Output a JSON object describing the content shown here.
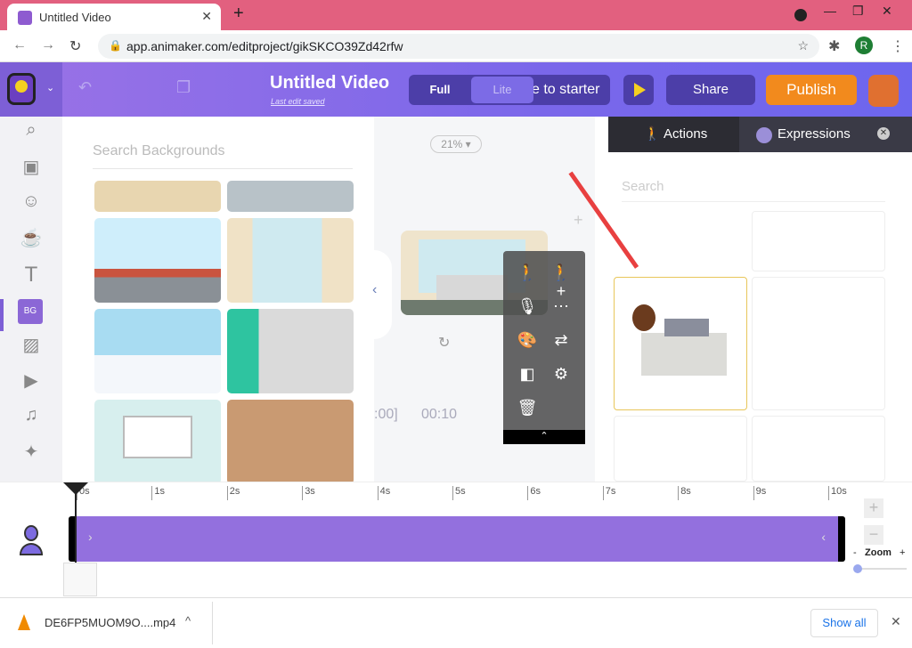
{
  "browser": {
    "tab_title": "Untitled Video",
    "url": "app.animaker.com/editproject/gikSKCO39Zd42rfw",
    "profile_initial": "R"
  },
  "header": {
    "title": "Untitled Video",
    "last_saved": "Last edit saved",
    "mode_full": "Full",
    "mode_lite": "Lite",
    "switch_label": "e to starter",
    "share": "Share",
    "publish": "Publish"
  },
  "left_rail": {
    "items": [
      "search-icon",
      "props-icon",
      "character-icon",
      "coffee-icon",
      "text-icon",
      "BG",
      "image-icon",
      "video-icon",
      "music-icon",
      "effects-icon"
    ],
    "selected": "BG"
  },
  "backgrounds": {
    "search_placeholder": "Search Backgrounds"
  },
  "canvas": {
    "zoom": "21%",
    "time_start": ":00]",
    "time_end": "00:10"
  },
  "right_panel": {
    "tab_actions": "Actions",
    "tab_expressions": "Expressions",
    "search_placeholder": "Search"
  },
  "timeline": {
    "ticks": [
      "0s",
      "1s",
      "2s",
      "3s",
      "4s",
      "5s",
      "6s",
      "7s",
      "8s",
      "9s",
      "10s"
    ],
    "zoom_label": "Zoom",
    "zoom_minus": "-",
    "zoom_plus": "+"
  },
  "download_bar": {
    "file": "DE6FP5MUOM9O....mp4",
    "show_all": "Show all"
  },
  "colors": {
    "accent": "#7d5fd6",
    "publish": "#f28a1d",
    "track": "#9370de",
    "tabbar": "#e2607f"
  }
}
